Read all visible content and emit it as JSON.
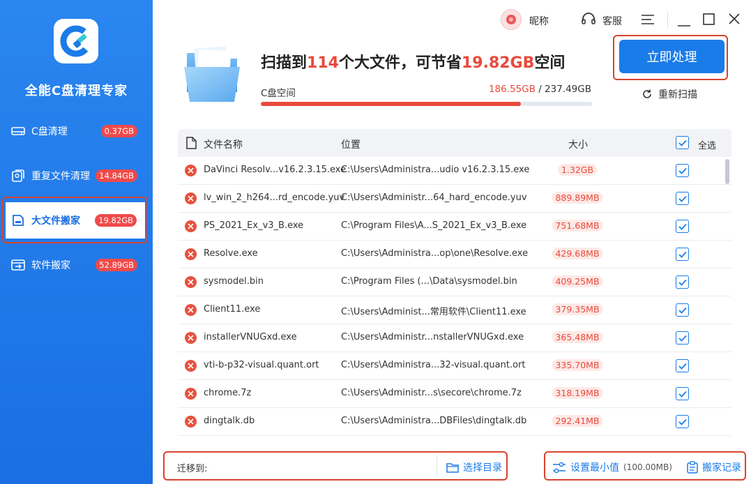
{
  "app": {
    "title": "全能C盘清理专家"
  },
  "sidebar": {
    "items": [
      {
        "label": "C盘清理",
        "badge": "0.37GB",
        "icon": "disk-icon"
      },
      {
        "label": "重复文件清理",
        "badge": "14.84GB",
        "icon": "duplicate-file-icon"
      },
      {
        "label": "大文件搬家",
        "badge": "19.82GB",
        "icon": "large-file-icon",
        "active": true
      },
      {
        "label": "软件搬家",
        "badge": "52.89GB",
        "icon": "software-move-icon"
      }
    ]
  },
  "topbar": {
    "nickname": "昵称",
    "service": "客服"
  },
  "header": {
    "prefix": "扫描到",
    "count": "114",
    "middle": "个大文件，可节省",
    "saving": "19.82GB",
    "suffix": "空间",
    "disk_label": "C盘空间",
    "disk_used": "186.55GB",
    "disk_total": " / 237.49GB",
    "disk_used_fraction": 0.7855,
    "process_button": "立即处理",
    "rescan": "重新扫描"
  },
  "table": {
    "headers": {
      "name": "文件名称",
      "location": "位置",
      "size": "大小",
      "select_all": "全选"
    },
    "rows": [
      {
        "name": "DaVinci Resolv...v16.2.3.15.exe",
        "location": "C:\\Users\\Administra...udio v16.2.3.15.exe",
        "size": "1.32GB"
      },
      {
        "name": "lv_win_2_h264...rd_encode.yuv",
        "location": "C:\\Users\\Administr...64_hard_encode.yuv",
        "size": "889.89MB"
      },
      {
        "name": "PS_2021_Ex_v3_B.exe",
        "location": "C:\\Program Files\\A...S_2021_Ex_v3_B.exe",
        "size": "751.68MB"
      },
      {
        "name": "Resolve.exe",
        "location": "C:\\Users\\Administra...op\\one\\Resolve.exe",
        "size": "429.68MB"
      },
      {
        "name": "sysmodel.bin",
        "location": "C:\\Program Files (...\\Data\\sysmodel.bin",
        "size": "409.25MB"
      },
      {
        "name": "Client11.exe",
        "location": "C:\\Users\\Administ...常用软件\\Client11.exe",
        "size": "379.35MB"
      },
      {
        "name": "installerVNUGxd.exe",
        "location": "C:\\Users\\Administr...nstallerVNUGxd.exe",
        "size": "365.48MB"
      },
      {
        "name": "vti-b-p32-visual.quant.ort",
        "location": "C:\\Users\\Administra...32-visual.quant.ort",
        "size": "335.70MB"
      },
      {
        "name": "chrome.7z",
        "location": "C:\\Users\\Administr...s\\secore\\chrome.7z",
        "size": "318.19MB"
      },
      {
        "name": "dingtalk.db",
        "location": "C:\\Users\\Administra...DBFiles\\dingtalk.db",
        "size": "292.41MB"
      }
    ]
  },
  "bottom": {
    "move_to_label": "迁移到:",
    "move_to_value": "",
    "pick_dir": "选择目录",
    "min_setting": "设置最小值",
    "min_value": "(100.00MB)",
    "move_log": "搬家记录"
  },
  "colors": {
    "accent": "#1a7ce8",
    "danger": "#e84a3b",
    "sidebar": "#2a86f0"
  }
}
